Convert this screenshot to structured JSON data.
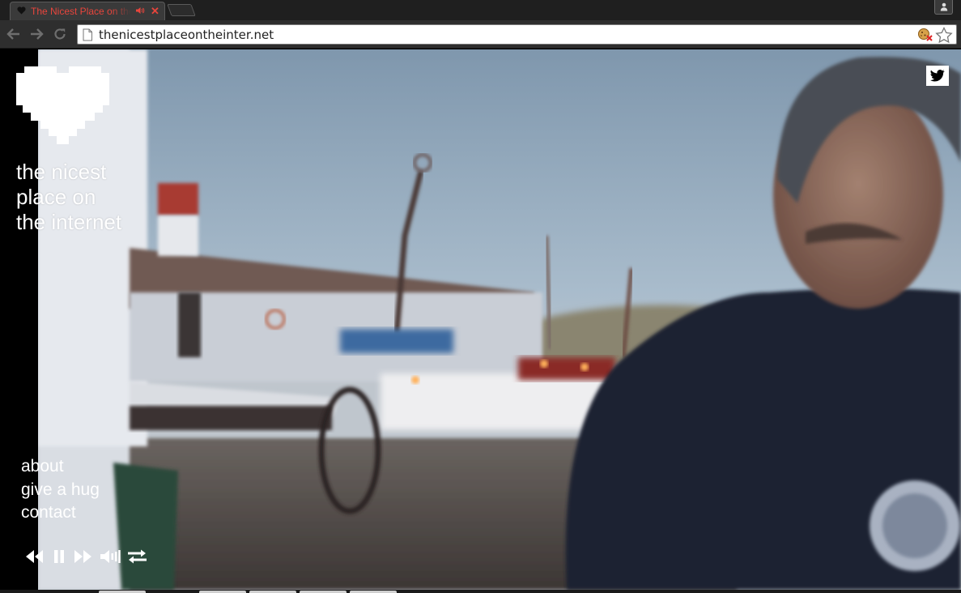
{
  "browser": {
    "tab": {
      "title": "The Nicest Place on the Internet",
      "favicon": "heart-icon",
      "audio": "speaker-icon",
      "close": "✕"
    },
    "address_bar": {
      "url": "thenicestplaceontheinter.net"
    }
  },
  "site": {
    "title_lines": [
      "the nicest",
      "place on",
      "the internet"
    ],
    "nav": [
      {
        "label": "about"
      },
      {
        "label": "give a hug"
      },
      {
        "label": "contact"
      }
    ],
    "player_controls": [
      "previous-icon",
      "pause-icon",
      "next-icon",
      "volume-icon",
      "shuffle-icon"
    ],
    "social": "twitter-icon"
  },
  "colors": {
    "tab_title": "#e8453c",
    "sidebar": "#000000",
    "text": "#ffffff"
  }
}
